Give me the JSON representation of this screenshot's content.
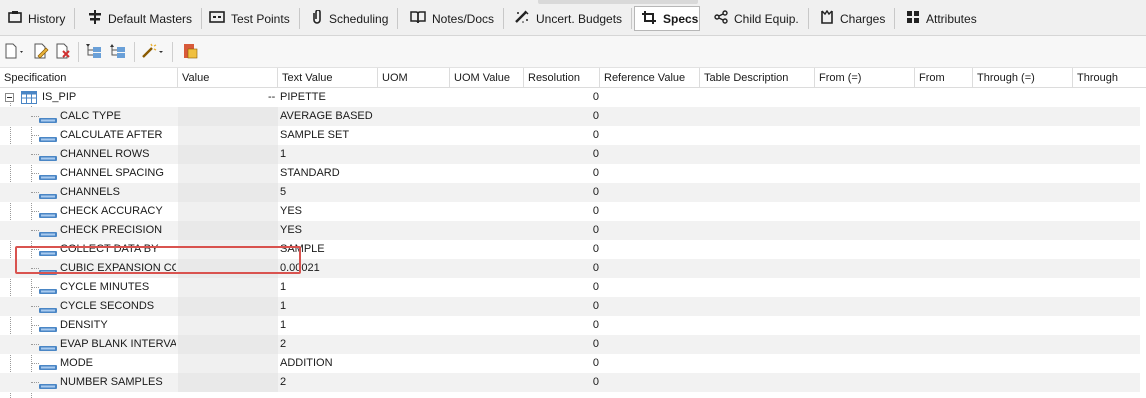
{
  "tabs": [
    {
      "label": "History",
      "icon": "history-icon"
    },
    {
      "label": "Default Masters",
      "icon": "default-masters-icon"
    },
    {
      "label": "Test Points",
      "icon": "test-points-icon"
    },
    {
      "label": "Scheduling",
      "icon": "scheduling-icon"
    },
    {
      "label": "Notes/Docs",
      "icon": "notes-docs-icon"
    },
    {
      "label": "Uncert. Budgets",
      "icon": "uncert-budgets-icon"
    },
    {
      "label": "Specs",
      "icon": "specs-icon",
      "active": true
    },
    {
      "label": "Child Equip.",
      "icon": "child-equip-icon"
    },
    {
      "label": "Charges",
      "icon": "charges-icon"
    },
    {
      "label": "Attributes",
      "icon": "attributes-icon"
    }
  ],
  "toolbar": {
    "buttons": [
      "new-icon",
      "edit-icon",
      "delete-icon",
      "tree-expand-icon",
      "tree-collapse-icon",
      "wand-icon",
      "export-icon"
    ]
  },
  "grid": {
    "columns": [
      "Specification",
      "Value",
      "Text Value",
      "UOM",
      "UOM Value",
      "Resolution",
      "Reference Value",
      "Table Description",
      "From (=)",
      "From",
      "Through (=)",
      "Through"
    ],
    "root": {
      "name": "IS_PIP",
      "value_dash": "--",
      "text_value": "PIPETTE",
      "resolution": "0"
    },
    "rows": [
      {
        "name": "CALC TYPE",
        "text_value": "AVERAGE BASED",
        "resolution": "0"
      },
      {
        "name": "CALCULATE AFTER",
        "text_value": "SAMPLE SET",
        "resolution": "0"
      },
      {
        "name": "CHANNEL ROWS",
        "text_value": "1",
        "resolution": "0"
      },
      {
        "name": "CHANNEL SPACING",
        "text_value": "STANDARD",
        "resolution": "0"
      },
      {
        "name": "CHANNELS",
        "text_value": "5",
        "resolution": "0"
      },
      {
        "name": "CHECK ACCURACY",
        "text_value": "YES",
        "resolution": "0"
      },
      {
        "name": "CHECK PRECISION",
        "text_value": "YES",
        "resolution": "0"
      },
      {
        "name": "COLLECT DATA BY",
        "text_value": "SAMPLE",
        "resolution": "0"
      },
      {
        "name": "CUBIC EXPANSION COE",
        "text_value": "0.00021",
        "resolution": "0"
      },
      {
        "name": "CYCLE MINUTES",
        "text_value": "1",
        "resolution": "0"
      },
      {
        "name": "CYCLE SECONDS",
        "text_value": "1",
        "resolution": "0"
      },
      {
        "name": "DENSITY",
        "text_value": "1",
        "resolution": "0"
      },
      {
        "name": "EVAP BLANK INTERVAL",
        "text_value": "2",
        "resolution": "0"
      },
      {
        "name": "MODE",
        "text_value": "ADDITION",
        "resolution": "0"
      },
      {
        "name": "NUMBER SAMPLES",
        "text_value": "2",
        "resolution": "0"
      }
    ]
  },
  "colors": {
    "highlight": "#d9534f",
    "alt_row": "#f2f2f2",
    "spec_icon": "#4a86c5"
  }
}
